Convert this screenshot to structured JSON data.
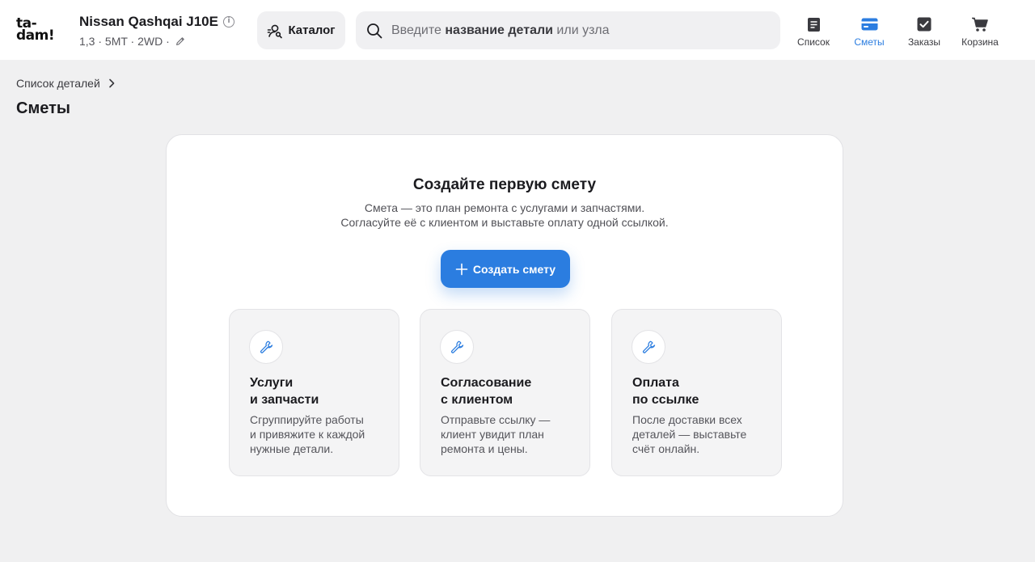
{
  "header": {
    "logo_line1": "ta-",
    "logo_line2": "dam!",
    "car_title": "Nissan Qashqai J10E",
    "car_specs": "1,3 · 5MT · 2WD ·",
    "catalog_label": "Каталог",
    "search": {
      "prefix": "Введите ",
      "bold": "название детали",
      "suffix": " или узла"
    },
    "nav": [
      {
        "label": "Список",
        "icon": "list-icon"
      },
      {
        "label": "Сметы",
        "icon": "estimates-card-icon",
        "active": true
      },
      {
        "label": "Заказы",
        "icon": "orders-check-icon"
      },
      {
        "label": "Корзина",
        "icon": "cart-icon"
      }
    ]
  },
  "breadcrumb": {
    "label": "Список деталей"
  },
  "page_title": "Сметы",
  "card": {
    "title": "Создайте первую смету",
    "desc_line1": "Смета — это план ремонта с услугами и запчастями.",
    "desc_line2": "Согласуйте её с клиентом и выставьте оплату одной ссылкой.",
    "create_label": "Создать смету",
    "features": [
      {
        "title1": "Услуги",
        "title2": "и запчасти",
        "desc1": "Сгруппируйте работы",
        "desc2": "и привяжите к каждой",
        "desc3": "нужные детали.",
        "icon": "wrench-icon"
      },
      {
        "title1": "Согласование",
        "title2": "с клиентом",
        "desc1": "Отправьте ссылку —",
        "desc2": "клиент увидит план",
        "desc3": "ремонта и цены.",
        "icon": "wrench-icon"
      },
      {
        "title1": "Оплата",
        "title2": "по ссылке",
        "desc1": "После доставки всех",
        "desc2": "деталей — выставьте",
        "desc3": "счёт онлайн.",
        "icon": "wrench-icon"
      }
    ]
  },
  "colors": {
    "accent": "#2b7de0",
    "background": "#f0f0f1"
  }
}
